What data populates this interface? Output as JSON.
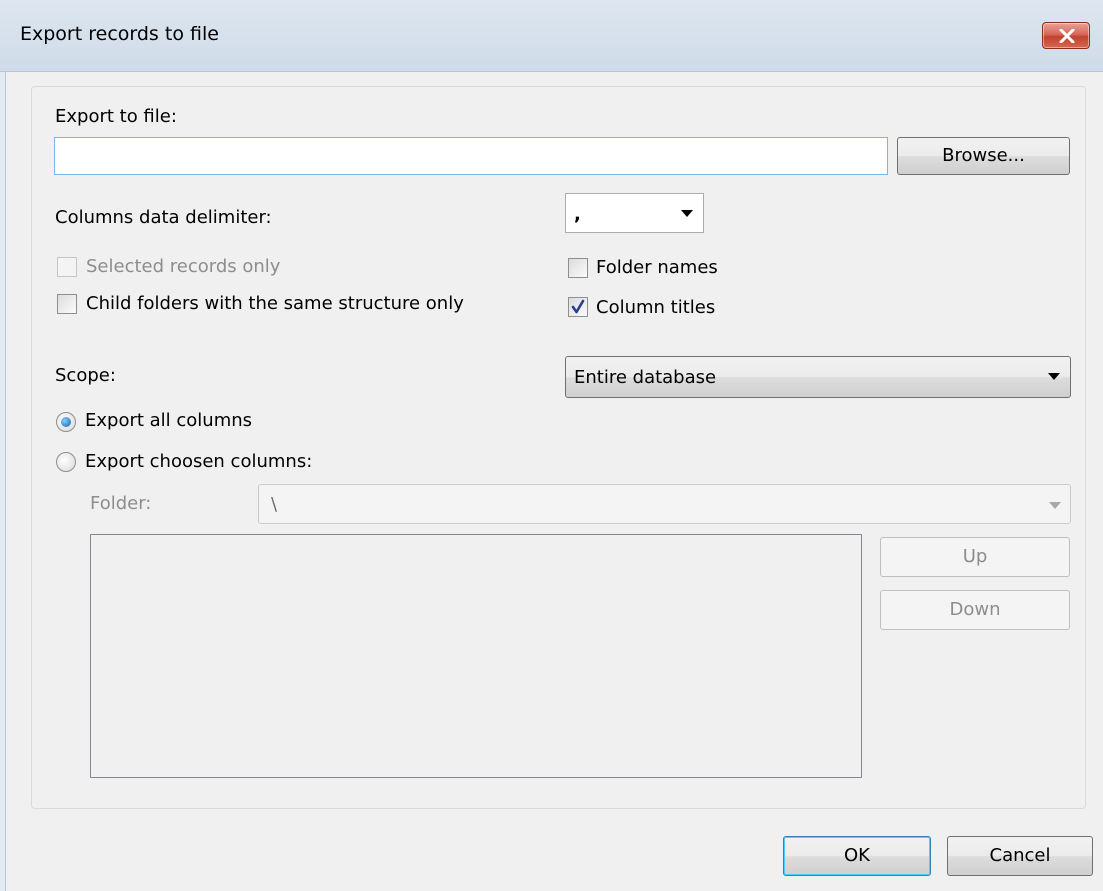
{
  "window": {
    "title": "Export records to file"
  },
  "export_to_file": {
    "label": "Export to file:",
    "value": "",
    "browse_label": "Browse..."
  },
  "delimiter": {
    "label": "Columns data delimiter:",
    "value": ","
  },
  "options": {
    "selected_records_only": {
      "label": "Selected records only",
      "checked": false,
      "enabled": false
    },
    "child_folders_same_structure": {
      "label": "Child folders with the same structure only",
      "checked": false,
      "enabled": true
    },
    "folder_names": {
      "label": "Folder names",
      "checked": false,
      "enabled": true
    },
    "column_titles": {
      "label": "Column titles",
      "checked": true,
      "enabled": true
    }
  },
  "scope": {
    "label": "Scope:",
    "value": "Entire database"
  },
  "columns_mode": {
    "export_all_label": "Export all columns",
    "export_chosen_label": "Export choosen columns:",
    "selected": "export_all"
  },
  "folder": {
    "label": "Folder:",
    "value": "\\"
  },
  "column_order": {
    "up_label": "Up",
    "down_label": "Down"
  },
  "footer": {
    "ok_label": "OK",
    "cancel_label": "Cancel"
  }
}
